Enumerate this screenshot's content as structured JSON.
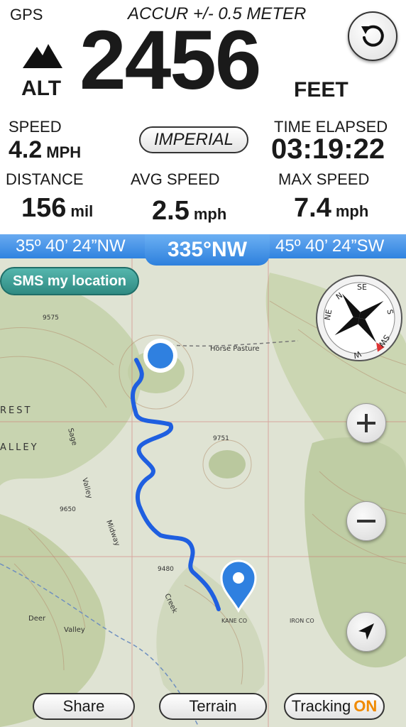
{
  "header": {
    "gps_label": "GPS",
    "accuracy": "ACCUR +/- 0.5 METER",
    "alt_label": "ALT",
    "altitude": "2456",
    "altitude_unit": "FEET"
  },
  "stats": {
    "speed_label": "SPEED",
    "speed_value": "4.2",
    "speed_unit": "MPH",
    "units_button": "IMPERIAL",
    "time_label": "TIME ELAPSED",
    "time_value": "03:19:22",
    "distance_label": "DISTANCE",
    "distance_value": "156",
    "distance_unit": "mil",
    "avg_label": "AVG SPEED",
    "avg_value": "2.5",
    "avg_unit": "mph",
    "max_label": "MAX SPEED",
    "max_value": "7.4",
    "max_unit": "mph"
  },
  "heading": {
    "left": "35º 40’ 24”NW",
    "center": "335°NW",
    "right": "45º 40’ 24”SW"
  },
  "map": {
    "sms_button": "SMS my location",
    "labels": {
      "horse_pasture": "Horse Pasture",
      "sage": "Sage",
      "valley": "Valley",
      "midway": "Midway",
      "creek": "Creek",
      "deer": "Deer",
      "valley2": "Valley",
      "rest": "REST",
      "alley": "ALLEY",
      "kane": "KANE CO",
      "iron": "IRON CO",
      "e9480": "9480",
      "e9751": "9751",
      "e9650": "9650",
      "e9575": "9575"
    },
    "compass_letters": {
      "n": "N",
      "ne": "NE",
      "se": "SE",
      "s": "S",
      "sw": "SW",
      "w": "W"
    },
    "colors": {
      "route": "#1f5fe0",
      "pin": "#2f80e0",
      "map_bg": "#dfe3d3"
    }
  },
  "toolbar": {
    "share": "Share",
    "terrain": "Terrain",
    "tracking": "Tracking",
    "tracking_state": "ON"
  },
  "icons": {
    "refresh": "refresh-icon",
    "mountain": "mountain-icon",
    "compass": "compass-icon",
    "zoom_in": "plus-icon",
    "zoom_out": "minus-icon",
    "locate": "location-arrow-icon",
    "pin": "map-pin-icon"
  }
}
